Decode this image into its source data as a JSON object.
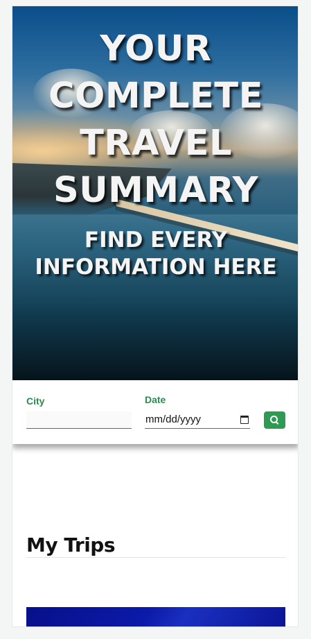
{
  "hero": {
    "title_lines": [
      "YOUR",
      "COMPLETE",
      "TRAVEL",
      "SUMMARY"
    ],
    "subtitle_lines": [
      "FIND EVERY",
      "INFORMATION HERE"
    ]
  },
  "search": {
    "city_label": "City",
    "city_value": "",
    "date_label": "Date",
    "date_placeholder": "mm/dd/yyyy",
    "button_icon": "search-icon",
    "accent_color": "#2e9b52"
  },
  "trips": {
    "section_title": "My Trips"
  }
}
